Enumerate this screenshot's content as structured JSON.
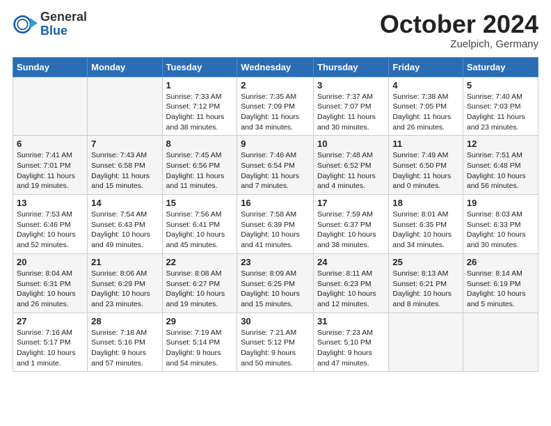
{
  "header": {
    "logo_general": "General",
    "logo_blue": "Blue",
    "month_title": "October 2024",
    "location": "Zuelpich, Germany"
  },
  "weekdays": [
    "Sunday",
    "Monday",
    "Tuesday",
    "Wednesday",
    "Thursday",
    "Friday",
    "Saturday"
  ],
  "rows": [
    [
      {
        "day": "",
        "info": ""
      },
      {
        "day": "",
        "info": ""
      },
      {
        "day": "1",
        "info": "Sunrise: 7:33 AM\nSunset: 7:12 PM\nDaylight: 11 hours\nand 38 minutes."
      },
      {
        "day": "2",
        "info": "Sunrise: 7:35 AM\nSunset: 7:09 PM\nDaylight: 11 hours\nand 34 minutes."
      },
      {
        "day": "3",
        "info": "Sunrise: 7:37 AM\nSunset: 7:07 PM\nDaylight: 11 hours\nand 30 minutes."
      },
      {
        "day": "4",
        "info": "Sunrise: 7:38 AM\nSunset: 7:05 PM\nDaylight: 11 hours\nand 26 minutes."
      },
      {
        "day": "5",
        "info": "Sunrise: 7:40 AM\nSunset: 7:03 PM\nDaylight: 11 hours\nand 23 minutes."
      }
    ],
    [
      {
        "day": "6",
        "info": "Sunrise: 7:41 AM\nSunset: 7:01 PM\nDaylight: 11 hours\nand 19 minutes."
      },
      {
        "day": "7",
        "info": "Sunrise: 7:43 AM\nSunset: 6:58 PM\nDaylight: 11 hours\nand 15 minutes."
      },
      {
        "day": "8",
        "info": "Sunrise: 7:45 AM\nSunset: 6:56 PM\nDaylight: 11 hours\nand 11 minutes."
      },
      {
        "day": "9",
        "info": "Sunrise: 7:46 AM\nSunset: 6:54 PM\nDaylight: 11 hours\nand 7 minutes."
      },
      {
        "day": "10",
        "info": "Sunrise: 7:48 AM\nSunset: 6:52 PM\nDaylight: 11 hours\nand 4 minutes."
      },
      {
        "day": "11",
        "info": "Sunrise: 7:49 AM\nSunset: 6:50 PM\nDaylight: 11 hours\nand 0 minutes."
      },
      {
        "day": "12",
        "info": "Sunrise: 7:51 AM\nSunset: 6:48 PM\nDaylight: 10 hours\nand 56 minutes."
      }
    ],
    [
      {
        "day": "13",
        "info": "Sunrise: 7:53 AM\nSunset: 6:46 PM\nDaylight: 10 hours\nand 52 minutes."
      },
      {
        "day": "14",
        "info": "Sunrise: 7:54 AM\nSunset: 6:43 PM\nDaylight: 10 hours\nand 49 minutes."
      },
      {
        "day": "15",
        "info": "Sunrise: 7:56 AM\nSunset: 6:41 PM\nDaylight: 10 hours\nand 45 minutes."
      },
      {
        "day": "16",
        "info": "Sunrise: 7:58 AM\nSunset: 6:39 PM\nDaylight: 10 hours\nand 41 minutes."
      },
      {
        "day": "17",
        "info": "Sunrise: 7:59 AM\nSunset: 6:37 PM\nDaylight: 10 hours\nand 38 minutes."
      },
      {
        "day": "18",
        "info": "Sunrise: 8:01 AM\nSunset: 6:35 PM\nDaylight: 10 hours\nand 34 minutes."
      },
      {
        "day": "19",
        "info": "Sunrise: 8:03 AM\nSunset: 6:33 PM\nDaylight: 10 hours\nand 30 minutes."
      }
    ],
    [
      {
        "day": "20",
        "info": "Sunrise: 8:04 AM\nSunset: 6:31 PM\nDaylight: 10 hours\nand 26 minutes."
      },
      {
        "day": "21",
        "info": "Sunrise: 8:06 AM\nSunset: 6:29 PM\nDaylight: 10 hours\nand 23 minutes."
      },
      {
        "day": "22",
        "info": "Sunrise: 8:08 AM\nSunset: 6:27 PM\nDaylight: 10 hours\nand 19 minutes."
      },
      {
        "day": "23",
        "info": "Sunrise: 8:09 AM\nSunset: 6:25 PM\nDaylight: 10 hours\nand 15 minutes."
      },
      {
        "day": "24",
        "info": "Sunrise: 8:11 AM\nSunset: 6:23 PM\nDaylight: 10 hours\nand 12 minutes."
      },
      {
        "day": "25",
        "info": "Sunrise: 8:13 AM\nSunset: 6:21 PM\nDaylight: 10 hours\nand 8 minutes."
      },
      {
        "day": "26",
        "info": "Sunrise: 8:14 AM\nSunset: 6:19 PM\nDaylight: 10 hours\nand 5 minutes."
      }
    ],
    [
      {
        "day": "27",
        "info": "Sunrise: 7:16 AM\nSunset: 5:17 PM\nDaylight: 10 hours\nand 1 minute."
      },
      {
        "day": "28",
        "info": "Sunrise: 7:18 AM\nSunset: 5:16 PM\nDaylight: 9 hours\nand 57 minutes."
      },
      {
        "day": "29",
        "info": "Sunrise: 7:19 AM\nSunset: 5:14 PM\nDaylight: 9 hours\nand 54 minutes."
      },
      {
        "day": "30",
        "info": "Sunrise: 7:21 AM\nSunset: 5:12 PM\nDaylight: 9 hours\nand 50 minutes."
      },
      {
        "day": "31",
        "info": "Sunrise: 7:23 AM\nSunset: 5:10 PM\nDaylight: 9 hours\nand 47 minutes."
      },
      {
        "day": "",
        "info": ""
      },
      {
        "day": "",
        "info": ""
      }
    ]
  ]
}
